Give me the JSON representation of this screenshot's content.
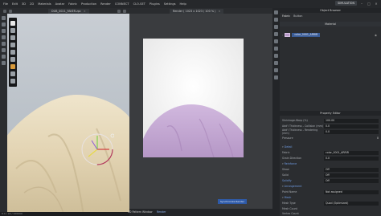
{
  "menu": [
    "File",
    "Edit",
    "3D",
    "2D",
    "Materials",
    "Avatar",
    "Fabric",
    "Production",
    "Render",
    "CONNECT",
    "CLO-SET",
    "Plugins",
    "Settings",
    "Help"
  ],
  "topright": {
    "mode_label": "SIMULATION"
  },
  "viewport3d": {
    "tab_label": "DUB_0021_FAKER.zpc",
    "status": "8.0 / 24 / 100000"
  },
  "viewport2d": {
    "tab_label": "Render  ( 1023 x 1023 / 100 % )",
    "bottom_tabs": [
      "2D Pattern Window",
      "Render"
    ],
    "blue_button": "Synchronize Render"
  },
  "object_browser": {
    "title": "Object Browser",
    "tabs": [
      "Fabric",
      "Button"
    ],
    "sub_title": "Material",
    "object_name": "color_0001_ARRIR"
  },
  "property_editor": {
    "title": "Property Editor",
    "rows": [
      {
        "label": "Shrinkage-Warp (%)",
        "value": "100.00"
      },
      {
        "label": "Add'l Thickness - Collision (mm)",
        "value": "0.0"
      },
      {
        "label": "Add'l Thickness - Rendering (mm)",
        "value": "0.0"
      }
    ],
    "pressure_label": "Pressure",
    "pressure_value": "0",
    "sections": [
      "Detail",
      "Fabric",
      "Grain Direction",
      "Reinforce",
      "Solidify",
      "Arrangement",
      "Mesh"
    ],
    "fabric_value": "color_0001_ARRIR",
    "grain_value": "0.0",
    "reinforce_rows": [
      {
        "label": "Show",
        "value": "Off"
      },
      {
        "label": "Solid",
        "value": "Off"
      }
    ],
    "arrangement_rows": [
      {
        "label": "Point Name",
        "value": "Not assigned"
      }
    ],
    "mesh_rows": [
      {
        "label": "Mesh Type",
        "value": "Quad (Optimized)"
      },
      {
        "label": "Mesh Count",
        "value": ""
      },
      {
        "label": "Vertex Count",
        "value": ""
      }
    ],
    "solidify_value": "Off"
  },
  "colors": {
    "fabric3d": "#e9dcc0",
    "fabric2d": "#c8a9d8",
    "accent": "#3a5c96"
  }
}
